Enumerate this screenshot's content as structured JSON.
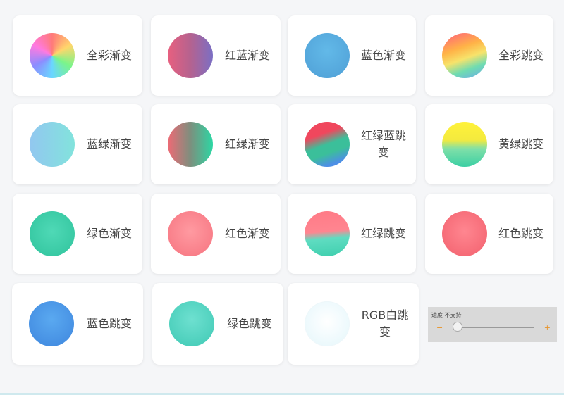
{
  "cards": [
    {
      "label": "全彩渐变"
    },
    {
      "label": "红蓝渐变"
    },
    {
      "label": "蓝色渐变"
    },
    {
      "label": "全彩跳变"
    },
    {
      "label": "蓝绿渐变"
    },
    {
      "label": "红绿渐变"
    },
    {
      "label": "红绿蓝跳变"
    },
    {
      "label": "黄绿跳变"
    },
    {
      "label": "绿色渐变"
    },
    {
      "label": "红色渐变"
    },
    {
      "label": "红绿跳变"
    },
    {
      "label": "红色跳变"
    },
    {
      "label": "蓝色跳变"
    },
    {
      "label": "绿色跳变"
    },
    {
      "label": "RGB白跳变"
    }
  ],
  "speed": {
    "label": "速度 不支持",
    "minus": "−",
    "plus": "+",
    "value_fraction": 0
  },
  "colors": {
    "accent": "#e8942a",
    "panel_bg": "#d9d9d9",
    "card_bg": "#ffffff"
  }
}
